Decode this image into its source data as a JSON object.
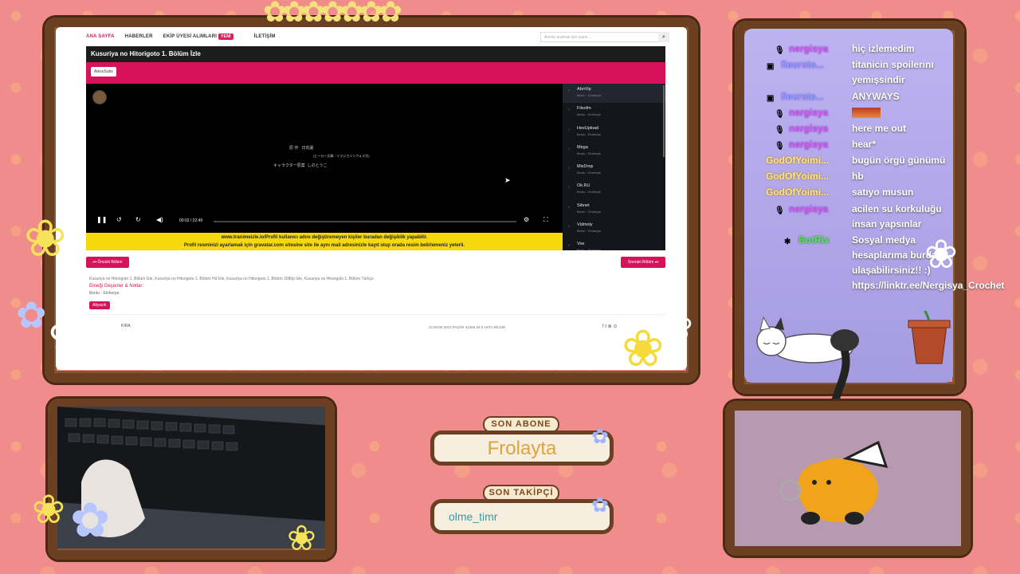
{
  "browser": {
    "nav": [
      "ANA SAYFA",
      "HABERLER",
      "EKİP ÜYESİ ALIMLARI",
      "İLETİŞİM"
    ],
    "nav_badge": "YENİ",
    "search_placeholder": "Anime aramak için yazın...",
    "episode_title": "Kusuriya no Hitorigoto 1. Bölüm İzle",
    "fansub_button": "AlesuSubs",
    "player": {
      "credit_line1_label": "原 作",
      "credit_line1_value": "日向夏",
      "credit_line1_sub": "(ヒーロー文庫／イマジカインフォス刊)",
      "credit_line2_label": "キャラクター原案",
      "credit_line2_value": "しのとうこ",
      "time": "00:02 / 22:49"
    },
    "notice_line1": "www.tranimeizle.io/Profil kullanıcı adını değiştiremeyen kişiler buradan değişiklik yapabilir.",
    "notice_line2": "Profil resminizi ayarlamak için gravatar.com sitesine site ile aynı mail adresinizle kayıt olup orada resim belirlemeniz yeterli.",
    "sources": [
      {
        "name": "AbnVip",
        "sub": "Bento · Einherjar"
      },
      {
        "name": "Filesfm",
        "sub": "Bento · Einherjar"
      },
      {
        "name": "HexUpload",
        "sub": "Bento · Einherjar"
      },
      {
        "name": "Mega",
        "sub": "Bento · Einherjar"
      },
      {
        "name": "MixDrop",
        "sub": "Bento · Einherjar"
      },
      {
        "name": "Ok.RU",
        "sub": "Bento · Einherjar"
      },
      {
        "name": "Sibnet",
        "sub": "Bento · Einherjar"
      },
      {
        "name": "Vidmoly",
        "sub": "Bento · Einherjar"
      },
      {
        "name": "Voe",
        "sub": "Bento · Einherjar"
      }
    ],
    "prev_label": "⏮ Önceki Bölüm",
    "next_label": "Sonraki Bölüm ⏭",
    "tags": "Kusuriya no Hitorigoto 1. Bölüm İzle, Kusuriya no Hitorigoto 1. Bölüm Hd İzle, Kusuriya no Hitorigoto 1. Bölüm 1080p İzle, Kusuriya no Hitorigoto 1. Bölüm Türkçe",
    "credit_title": "Emeği Geçenler & Notlar:",
    "credit_text": "Bento - Einherjar",
    "pill": "Altyazılı",
    "author": "KIRA",
    "stats": "22 EKİM 2023 PAZAR   41366   26   0   HATA BİLDİR",
    "socials": "f  t  ⊕  ⊙"
  },
  "chat": [
    {
      "user": "nergisya",
      "text": "hiç izlemedim",
      "kind": "mic"
    },
    {
      "user": "fleursto...",
      "text": "titanicin spoilerını yemişsindir",
      "kind": "blue"
    },
    {
      "user": "fleursto...",
      "text": "ANYWAYS",
      "kind": "blue"
    },
    {
      "user": "nergisya",
      "text": "",
      "kind": "mic"
    },
    {
      "user": "nergisya",
      "text": "here me out",
      "kind": "mic"
    },
    {
      "user": "nergisya",
      "text": "hear*",
      "kind": "mic"
    },
    {
      "user": "GodOfYoimi...",
      "text": "bugün örgü günümü",
      "kind": "gold"
    },
    {
      "user": "GodOfYoimi...",
      "text": "hb",
      "kind": "gold"
    },
    {
      "user": "GodOfYoimi...",
      "text": "satıyo musun",
      "kind": "gold"
    },
    {
      "user": "nergisya",
      "text": "acilen su korkuluğu insan yapsınlar",
      "kind": "mic"
    },
    {
      "user": "BotRix",
      "text": "Sosyal medya hesaplarıma burdan ulaşabilirsiniz!! :) https://linktr.ee/Nergisya_Crochet",
      "kind": "bot"
    }
  ],
  "overlay": {
    "sub_title": "SON ABONE",
    "sub_name": "Frolayta",
    "follow_title": "SON TAKİPÇİ",
    "follow_name": "olme_timr"
  },
  "colors": {
    "accent": "#d6135a",
    "notice": "#f5d90c",
    "wood": "#6b3f22",
    "background": "#f08c8c"
  }
}
